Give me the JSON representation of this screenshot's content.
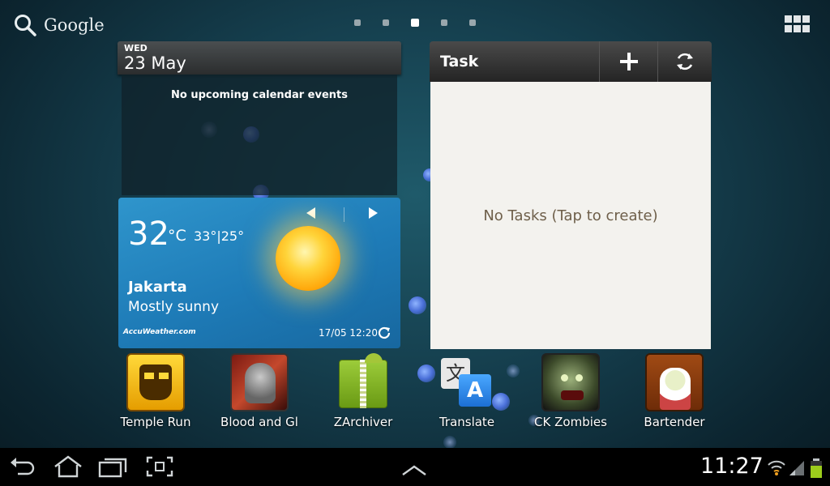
{
  "search": {
    "label": "Google"
  },
  "pages": {
    "count": 5,
    "active_index": 2
  },
  "calendar": {
    "day": "WED",
    "date": "23 May",
    "empty_message": "No upcoming calendar events"
  },
  "weather": {
    "temp": "32",
    "unit": "°C",
    "hi_lo": "33°|25°",
    "city": "Jakarta",
    "condition": "Mostly sunny",
    "brand": "AccuWeather.com",
    "updated": "17/05 12:20"
  },
  "task": {
    "title": "Task",
    "empty_message": "No Tasks (Tap to create)"
  },
  "apps": [
    {
      "label": "Temple Run",
      "icon": "temple-run-icon"
    },
    {
      "label": "Blood and Gl",
      "icon": "blood-and-glory-icon"
    },
    {
      "label": "ZArchiver",
      "icon": "zarchiver-icon"
    },
    {
      "label": "Translate",
      "icon": "translate-icon"
    },
    {
      "label": "CK Zombies",
      "icon": "ck-zombies-icon"
    },
    {
      "label": "Bartender",
      "icon": "bartender-icon"
    }
  ],
  "statusbar": {
    "time": "11:27"
  }
}
